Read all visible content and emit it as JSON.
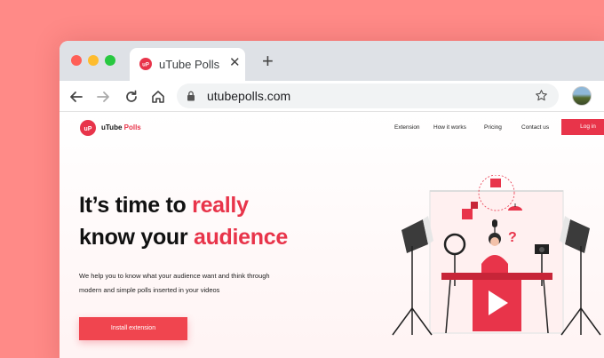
{
  "browser": {
    "tab": {
      "title": "uTube Polls",
      "close_glyph": "✕"
    },
    "new_tab_glyph": "+",
    "address": {
      "url": "utubepolls.com"
    },
    "icons": [
      "back-arrow-icon",
      "forward-arrow-icon",
      "reload-icon",
      "home-icon",
      "lock-icon",
      "bookmark-star-icon"
    ]
  },
  "site": {
    "logo": {
      "mark": "uP",
      "name_part1": "uTube",
      "name_part2": "Polls"
    },
    "nav": [
      {
        "label": "Extension"
      },
      {
        "label": "How it works"
      },
      {
        "label": "Pricing"
      },
      {
        "label": "Contact us"
      }
    ],
    "login_label": "Log in",
    "hero": {
      "line1_prefix": "It’s time to ",
      "line1_accent": "really",
      "line2_prefix": "know your ",
      "line2_accent": "audience"
    },
    "lead_line1": "We help you to know what your audience want and think through",
    "lead_line2": "modern and simple polls inserted in your videos",
    "cta_label": "Install extension",
    "illustration_question_mark": "?"
  },
  "colors": {
    "background": "#ff8a87",
    "brand": "#e8344a",
    "cta": "#f0454f"
  }
}
